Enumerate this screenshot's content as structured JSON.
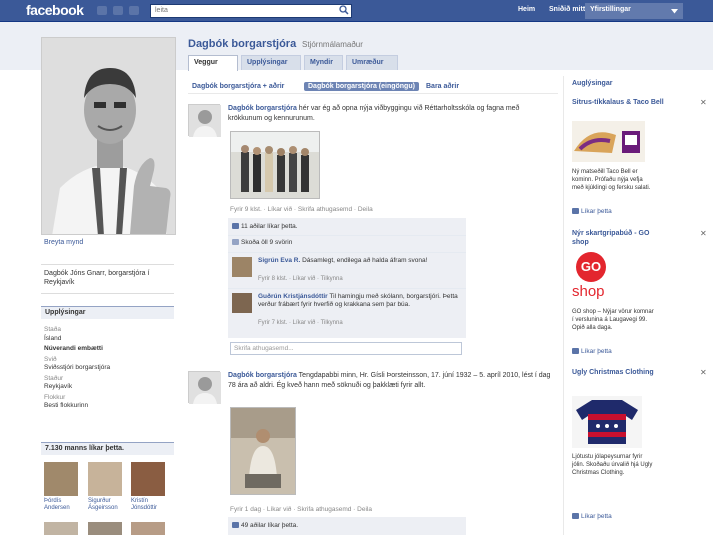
{
  "topbar": {
    "logo": "facebook",
    "search_placeholder": "leita",
    "nav": [
      "Heim",
      "Sniðið mitt",
      "Yfirstillingar"
    ]
  },
  "profile": {
    "name": "Dagbók borgarstjóra",
    "subtitle": "Stjórnmálamaður",
    "edit_photo": "Breyta mynd",
    "about": "Dagbók Jóns Gnarr, borgarstjóra í Reykjavík",
    "tabs": [
      "Veggur",
      "Upplýsingar",
      "Myndir",
      "Umræður"
    ]
  },
  "info": {
    "heading": "Upplýsingar",
    "items": [
      {
        "key": "Staða",
        "value": "Ísland"
      },
      {
        "key": "",
        "value": "Núverandi embætti"
      },
      {
        "key": "Svið",
        "value": "Sviðsstjóri borgarstjóra"
      },
      {
        "key": "Staður",
        "value": "Reykjavík"
      },
      {
        "key": "Flokkur",
        "value": "Besti flokkurinn"
      }
    ]
  },
  "likes": {
    "heading": "7.130 manns líkar þetta.",
    "fans": [
      {
        "name": "Þórdís Andersen"
      },
      {
        "name": "Sigurður Ásgeirsson"
      },
      {
        "name": "Kristín Jónsdóttir"
      }
    ]
  },
  "filters": [
    "Dagbók borgarstjóra + aðrir",
    "Dagbók borgarstjóra (eingöngu)",
    "Bara aðrir"
  ],
  "posts": [
    {
      "author": "Dagbók borgarstjóra",
      "text": " hér var ég að opna nýja viðbyggingu við Réttarholtsskóla og fagna með krökkunum og kennurunum.",
      "meta": "Fyrir 9 klst. · Líkar við · Skrifa athugasemd · Deila",
      "ufi": {
        "likes": "11 aðilar líkar þetta.",
        "view_all": "Skoða öll 9 svörin",
        "comments": [
          {
            "author": "Sigrún Eva R.",
            "text": " Dásamlegt, endilega að halda áfram svona!",
            "meta": "Fyrir 8 klst. · Líkar við · Tilkynna"
          },
          {
            "author": "Guðrún Kristjánsdóttir",
            "text": " Til hamingju með skólann, borgarstjóri. Þetta verður frábært fyrir hverfið og krakkana sem þar búa.",
            "meta": "Fyrir 7 klst. · Líkar við · Tilkynna"
          }
        ],
        "write": "Skrifa athugasemd..."
      }
    },
    {
      "author": "Dagbók borgarstjóra",
      "text": " Tengdapabbi minn, Hr. Gísli Þorsteinsson, 17. júní 1932 – 5. apríl 2010, lést í dag 78 ára að aldri. Ég kveð hann með söknuði og þakklæti fyrir allt.",
      "meta": "Fyrir 1 dag · Líkar við · Skrifa athugasemd · Deila",
      "ufi": {
        "likes": "49 aðilar líkar þetta."
      }
    }
  ],
  "sidebar": {
    "heading": "Auglýsingar",
    "ads": [
      {
        "title": "Sitrus-tíkkalaus & Taco Bell",
        "body": "Ný matseðill Taco Bell er kominn. Prófaðu nýja vefja með kjúklingi og fersku salati.",
        "like": "Líkar þetta"
      },
      {
        "title": "Nýr skartgripabúð - GO shop",
        "brand": "GO",
        "brand_sub": "shop",
        "body": "GO shop – Nýjar vörur komnar í verslunina á Laugavegi 99. Opið alla daga.",
        "like": "Líkar þetta"
      },
      {
        "title": "Ugly Christmas Clothing",
        "body": "Ljótustu jólapeysurnar fyrir jólin. Skoðaðu úrvalið hjá Ugly Christmas Clothing.",
        "like": "Líkar þetta"
      }
    ]
  },
  "colors": {
    "brand": "#3b5998",
    "nav_bg": "#3b5998",
    "header_bg": "#eceff5",
    "ufi_bg": "#edeff4"
  }
}
